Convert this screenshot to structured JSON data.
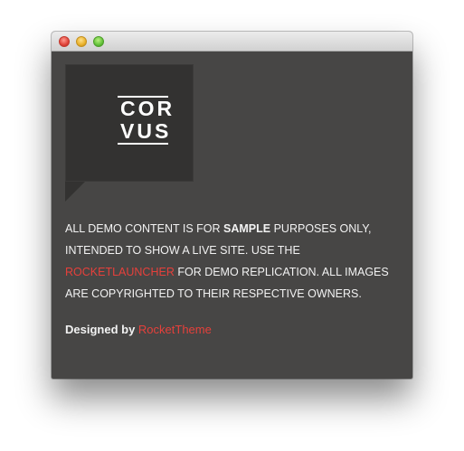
{
  "window": {
    "buttons": {
      "close": "close",
      "minimize": "minimize",
      "maximize": "zoom"
    }
  },
  "logo": {
    "line1": "COR",
    "line2": "VUS"
  },
  "notice": {
    "part1": "All demo content is for ",
    "bold": "sample",
    "part2": " purposes only,",
    "line2": "intended to show a live site. Use the",
    "link": "RocketLauncher",
    "part3": " for demo replication. All images",
    "line4": "are copyrighted to their respective owners."
  },
  "credit": {
    "prefix": "Designed by",
    "link": "RocketTheme"
  },
  "colors": {
    "accent": "#e6403b",
    "background": "#474645",
    "logo_box": "#333231"
  }
}
